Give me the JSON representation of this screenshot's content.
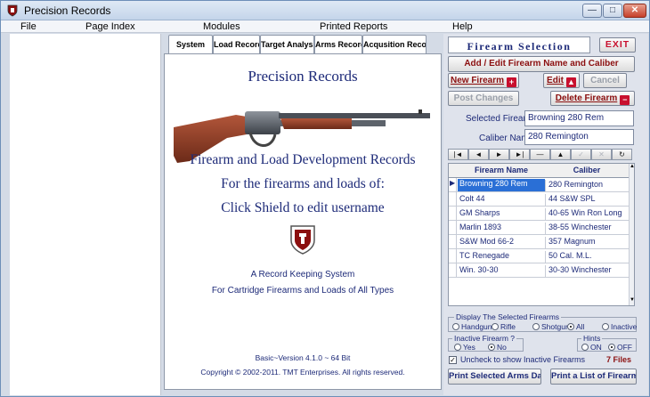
{
  "window": {
    "title": "Precision Records",
    "min_glyph": "—",
    "max_glyph": "□",
    "close_glyph": "✕"
  },
  "menu": [
    "File",
    "Page Index",
    "Modules",
    "Printed Reports",
    "Help"
  ],
  "tabs": [
    "System",
    "Load Records",
    "Target Analysis",
    "Arms Record",
    "Acqusition Record"
  ],
  "center": {
    "title": "Precision Records",
    "line1": "Firearm and Load Development Records",
    "line2": "For the firearms and loads of:",
    "line3": "Click Shield to edit username",
    "tagline1": "A Record Keeping System",
    "tagline2": "For Cartridge Firearms and Loads of All Types",
    "version": "Basic~Version 4.1.0 ~ 64 Bit",
    "copyright": "Copyright © 2002-2011. TMT Enterprises. All rights reserved."
  },
  "right": {
    "heading": "Firearm Selection",
    "exit": "EXIT",
    "add_edit": "Add / Edit Firearm Name and Caliber",
    "new_firearm": "New Firearm",
    "edit": "Edit",
    "cancel": "Cancel",
    "post_changes": "Post Changes",
    "delete_firearm": "Delete Firearm",
    "selected_label": "Selected Firearm",
    "selected_value": "Browning 280 Rem",
    "caliber_label": "Caliber Name",
    "caliber_value": "280 Remington",
    "nav": [
      "|◄",
      "◄",
      "►",
      "►|",
      "—",
      "▲",
      "✓",
      "✕",
      "↻"
    ],
    "grid_headers": [
      "Firearm Name",
      "Caliber"
    ],
    "rows": [
      [
        "Browning 280 Rem",
        "280 Remington"
      ],
      [
        "Colt 44",
        "44 S&W SPL"
      ],
      [
        "GM Sharps",
        "40-65 Win Ron Long"
      ],
      [
        "Marlin 1893",
        "38-55 Winchester"
      ],
      [
        "S&W Mod 66-2",
        "357 Magnum"
      ],
      [
        "TC Renegade",
        "50 Cal. M.L."
      ],
      [
        "Win. 30-30",
        "30-30 Winchester"
      ]
    ],
    "display_group": "Display The Selected Firearms",
    "display_options": [
      "Handgun",
      "Rifle",
      "Shotgun",
      "All",
      "Inactive"
    ],
    "inactive_group": "Inactive Firearm ?",
    "inactive_options": [
      "Yes",
      "No"
    ],
    "hints_group": "Hints",
    "hints_options": [
      "ON",
      "OFF"
    ],
    "uncheck_label": "Uncheck to show Inactive Firearms",
    "files_count": "7 Files",
    "print_selected": "Print Selected Arms Data",
    "print_list": "Print a List of Firearms"
  },
  "colors": {
    "accent": "#8b0f0f",
    "text_blue": "#1d2a78",
    "selection": "#2a6fd6"
  }
}
